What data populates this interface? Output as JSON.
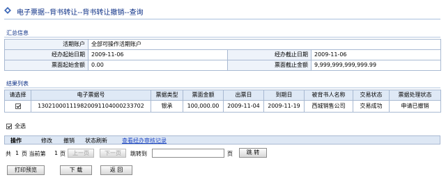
{
  "title": {
    "text": "电子票据--背书转让--背书转让撤销--查询"
  },
  "summary": {
    "section_title": "汇总信息",
    "rows": [
      {
        "label": "活期账户",
        "value": "全部可操作活期账户"
      },
      {
        "label": "经办起始日期",
        "value": "2009-11-06",
        "label2": "经办截止日期",
        "value2": "2009-11-06"
      },
      {
        "label": "票面起始金额",
        "value": "0.00",
        "label2": "票面截止金额",
        "value2": "9,999,999,999,999.99"
      }
    ]
  },
  "results": {
    "section_title": "结果列表",
    "headers": [
      "请选择",
      "电子票据号",
      "票据类型",
      "票面金额",
      "出票日",
      "到期日",
      "被背书人名称",
      "交易状态",
      "票据处理状态"
    ],
    "rows": [
      {
        "selected": true,
        "bill_no": "130210001119820091104000233702",
        "type": "银承",
        "amount": "100,000.00",
        "issue_date": "2009-11-04",
        "due_date": "2009-11-19",
        "endorsee": "西城销售公司",
        "trade_status": "交易成功",
        "process_status": "申请已撤销"
      }
    ]
  },
  "select_all": {
    "label": "全选",
    "checked": true
  },
  "ops": {
    "header": "操作",
    "modify": "修改",
    "cancel": "撤销",
    "refresh": "状态刷新",
    "audit_link": "查看经办审核记录"
  },
  "pager": {
    "total_prefix": "共",
    "total_pages": "1",
    "total_suffix": "页 当前第",
    "current_page": "1",
    "current_suffix": "页",
    "prev_label": "上一页",
    "next_label": "下一页",
    "jump_prefix": "跳转到",
    "jump_value": "",
    "page_unit": "页",
    "go_label": "跳 转"
  },
  "actions": {
    "print_preview": "打印预览",
    "download": "下 载",
    "back": "返 回"
  },
  "colors": {
    "title_text": "#0b2f86",
    "link": "#1f47c4",
    "table_border": "#a8b9d2",
    "header_bg": "#dfe9f6"
  },
  "icons": {
    "title_icon": "diamond-arrow-icon"
  }
}
